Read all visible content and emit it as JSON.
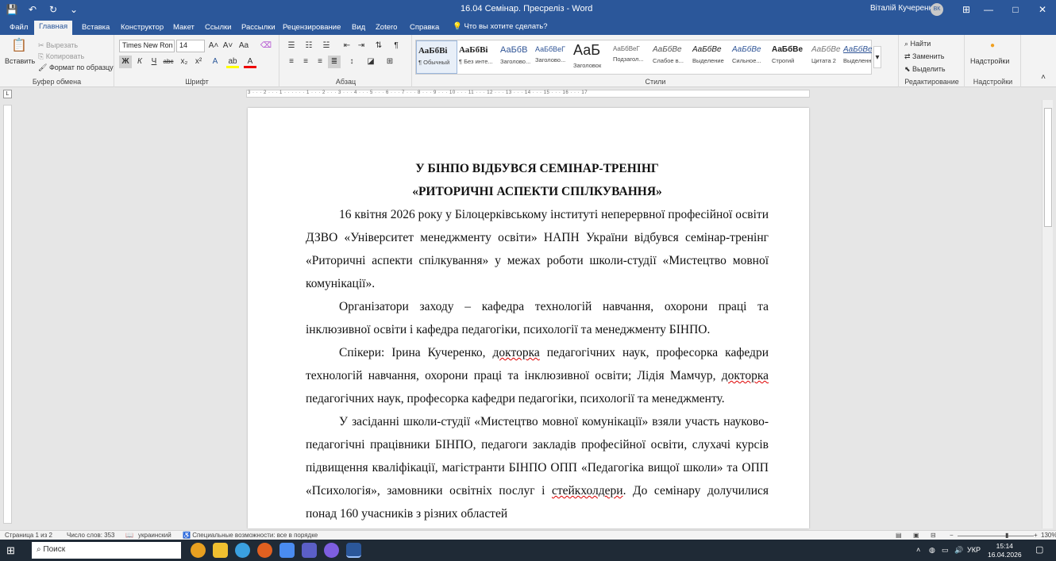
{
  "titlebar": {
    "document_title": "16.04 Семінар. Пресреліз  -  Word",
    "user_name": "Віталій Кучеренко",
    "user_initials": "ВК",
    "qat_save": "💾",
    "qat_undo": "↶",
    "qat_redo": "↻",
    "qat_more": "⌄",
    "ribbon_display_icon": "⊞",
    "minimize": "—",
    "maximize": "□",
    "close": "✕"
  },
  "tabs": [
    "Файл",
    "Главная",
    "Вставка",
    "Конструктор",
    "Макет",
    "Ссылки",
    "Рассылки",
    "Рецензирование",
    "Вид",
    "Zotero",
    "Справка"
  ],
  "active_tab": "Главная",
  "tell_me": "Что вы хотите сделать?",
  "ribbon": {
    "clipboard": {
      "label": "Буфер обмена",
      "paste": "Вставить",
      "cut": "Вырезать",
      "copy": "Копировать",
      "format_painter": "Формат по образцу"
    },
    "font": {
      "label": "Шрифт",
      "font_name": "Times New Ron",
      "font_size": "14",
      "bold": "Ж",
      "italic": "К",
      "underline": "Ч",
      "strike": "abc",
      "subscript": "x₂",
      "superscript": "x²",
      "grow": "A˄",
      "shrink": "A˅",
      "case": "Aa"
    },
    "paragraph": {
      "label": "Абзац"
    },
    "styles": {
      "label": "Стили",
      "items": [
        {
          "preview": "АаБбВі",
          "label": "¶ Обычный"
        },
        {
          "preview": "АаБбВі",
          "label": "¶ Без инте..."
        },
        {
          "preview": "АаБбВ",
          "label": "Заголово..."
        },
        {
          "preview": "АаБбВеГ",
          "label": "Заголово..."
        },
        {
          "preview": "АаБ",
          "label": "Заголовок"
        },
        {
          "preview": "АаБбВеГ",
          "label": "Подзагол..."
        },
        {
          "preview": "АаБбВе",
          "label": "Слабое в..."
        },
        {
          "preview": "АаБбВе",
          "label": "Выделение"
        },
        {
          "preview": "АаБбВе",
          "label": "Сильное..."
        },
        {
          "preview": "АаБбВе",
          "label": "Строгий"
        },
        {
          "preview": "АаБбВе",
          "label": "Цитата 2"
        },
        {
          "preview": "АаБбВе",
          "label": "Выделенн..."
        }
      ]
    },
    "editing": {
      "label": "Редактирование",
      "find": "Найти",
      "replace": "Заменить",
      "select": "Выделить"
    },
    "addins": {
      "label": "Надстройки",
      "button": "Надстройки"
    }
  },
  "document": {
    "heading_line1": "У БІНПО ВІДБУВСЯ СЕМІНАР-ТРЕНІНГ",
    "heading_line2": "«РИТОРИЧНІ АСПЕКТИ СПІЛКУВАННЯ»",
    "p1": "16 квітня 2026 року у Білоцерківському інституті неперервної професійної освіти ДЗВО «Університет менеджменту освіти» НАПН України відбувся семінар-тренінг «Риторичні аспекти спілкування» у межах роботи школи-студії «Мистецтво мовної комунікації».",
    "p2": "Організатори заходу – кафедра технологій навчання, охорони праці та інклюзивної освіти і кафедра педагогіки, психології та менеджменту БІНПО.",
    "p3_a": "Спікери: Ірина Кучеренко, ",
    "p3_b": "докторка",
    "p3_c": " педагогічних наук, професорка кафедри технологій навчання, охорони праці та інклюзивної освіти; Лідія Мамчур, ",
    "p3_d": "докторка",
    "p3_e": " педагогічних наук, професорка кафедри педагогіки, психології та менеджменту.",
    "p4_a": "У засіданні школи-студії «Мистецтво мовної комунікації» взяли участь науково-педагогічні працівники БІНПО, педагоги закладів професійної освіти, слухачі курсів підвищення кваліфікації, магістранти БІНПО ОПП «Педагогіка вищої школи» та ОПП «Психологія», замовники освітніх послуг і ",
    "p4_b": "стейкхолдери",
    "p4_c": ". До семінару долучилися понад 160 учасників з різних областей"
  },
  "statusbar": {
    "page": "Страница 1 из 2",
    "words": "Число слов: 353",
    "language": "украинский",
    "accessibility": "Специальные возможности: все в порядке",
    "zoom": "130%"
  },
  "taskbar": {
    "search_placeholder": "Поиск",
    "language": "УКР",
    "time": "15:14",
    "date": "16.04.2026"
  }
}
